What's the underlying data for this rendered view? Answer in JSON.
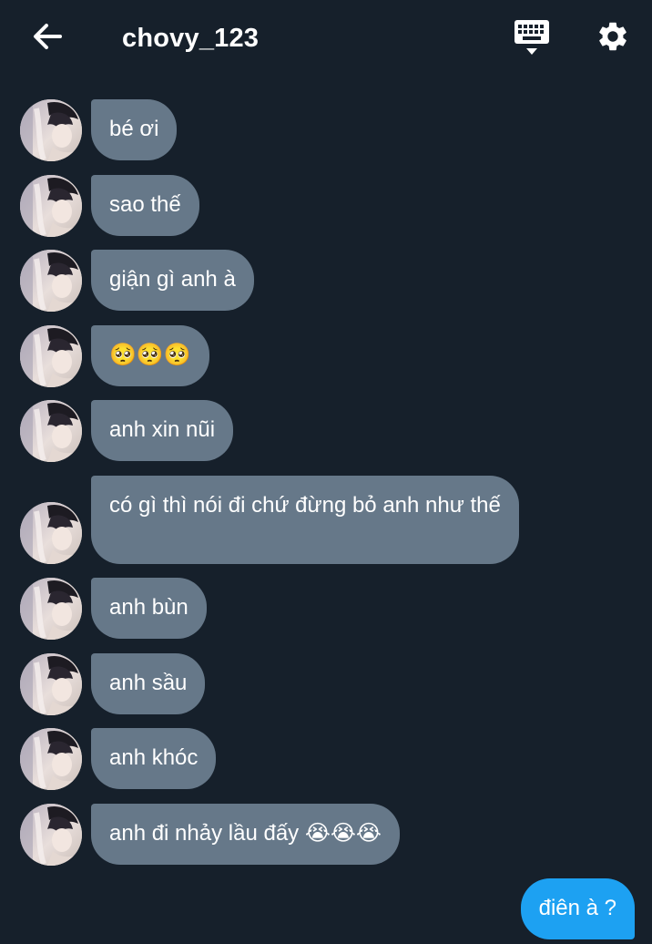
{
  "header": {
    "title": "chovy_123",
    "back_icon": "arrow-left-icon",
    "keyboard_icon": "keyboard-icon",
    "settings_icon": "gear-icon"
  },
  "colors": {
    "background": "#16202b",
    "incoming_bubble": "#667889",
    "outgoing_bubble": "#1da1f2",
    "text": "#ffffff"
  },
  "messages_in": [
    {
      "text": "bé ơi"
    },
    {
      "text": "sao thế"
    },
    {
      "text": "giận gì anh à"
    },
    {
      "text": "🥺🥺🥺"
    },
    {
      "text": "anh xin nũi"
    },
    {
      "text": "có gì thì nói đi chứ đừng bỏ anh như thế"
    },
    {
      "text": "anh bùn"
    },
    {
      "text": "anh sầu"
    },
    {
      "text": "anh khóc"
    },
    {
      "text": "anh đi nhảy lầu đấy 😭😭😭"
    }
  ],
  "messages_out": [
    {
      "text": "điên à ?"
    }
  ]
}
